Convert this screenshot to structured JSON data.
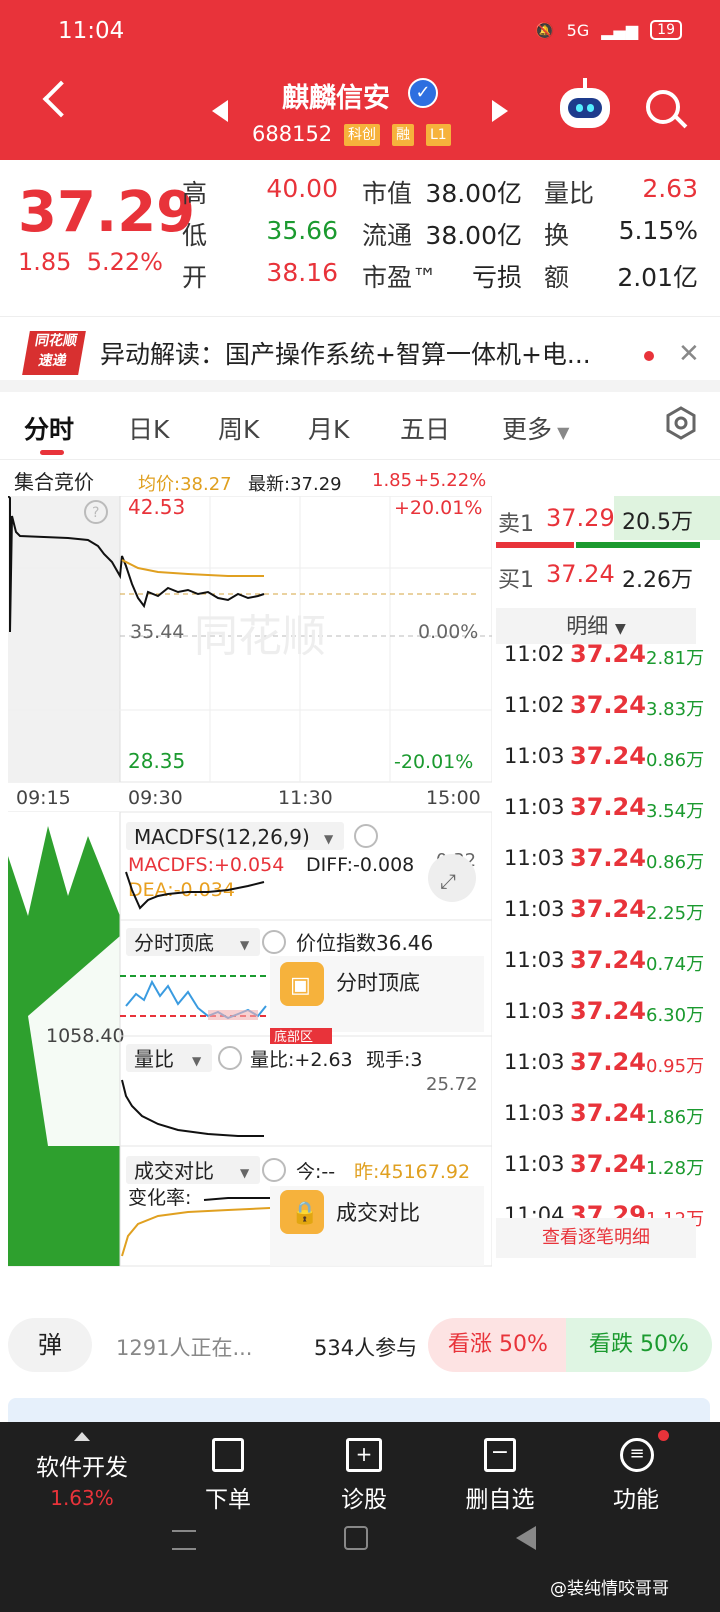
{
  "status": {
    "time": "11:04",
    "network": "5G",
    "battery": "19"
  },
  "header": {
    "name": "麒麟信安",
    "code": "688152",
    "tags": [
      "科创",
      "融",
      "L1"
    ]
  },
  "quote": {
    "price": "37.29",
    "change": "1.85",
    "pct": "5.22%",
    "rows": [
      {
        "l1": "高",
        "v1": "40.00",
        "l2": "市值",
        "v2": "38.00亿",
        "l3": "量比",
        "v3": "2.63"
      },
      {
        "l1": "低",
        "v1": "35.66",
        "l2": "流通",
        "v2": "38.00亿",
        "l3": "换",
        "v3": "5.15%"
      },
      {
        "l1": "开",
        "v1": "38.16",
        "l2": "市盈™",
        "v2": "亏损",
        "l3": "额",
        "v3": "2.01亿"
      }
    ]
  },
  "news": {
    "logo_top": "同花顺",
    "logo_bottom": "速递",
    "text": "异动解读：国产操作系统+智算一体机+电..."
  },
  "tabs": [
    "分时",
    "日K",
    "周K",
    "月K",
    "五日",
    "更多"
  ],
  "info": {
    "auction": "集合竞价",
    "avg": "均价:38.27",
    "latest": "最新:37.29",
    "chg": "1.85",
    "pct": "+5.22%"
  },
  "chart": {
    "price_high": "42.53",
    "pct_high": "+20.01%",
    "price_mid": "35.44",
    "pct_mid": "0.00%",
    "price_low": "28.35",
    "pct_low": "-20.01%",
    "watermark": "同花顺",
    "times": [
      "09:15",
      "09:30",
      "11:30",
      "15:00"
    ],
    "auction_vol": "1058.40",
    "macd": {
      "title": "MACDFS(12,26,9)",
      "macdfs": "MACDFS:+0.054",
      "diff": "DIFF:-0.008",
      "dea": "DEA:-0.034",
      "max": "0.32"
    },
    "top": {
      "title": "分时顶底",
      "idx": "价位指数36.46",
      "badge": "分时顶底",
      "cut": "底部区"
    },
    "vr": {
      "title": "量比",
      "val": "量比:+2.63",
      "hand": "现手:3",
      "max": "25.72"
    },
    "deal": {
      "title": "成交对比",
      "today": "今:--",
      "yest": "昨:45167.92",
      "rate": "变化率:",
      "badge": "成交对比"
    }
  },
  "orderbook": {
    "sell": {
      "label": "卖1",
      "price": "37.29",
      "vol": "20.5万"
    },
    "buy": {
      "label": "买1",
      "price": "37.24",
      "vol": "2.26万"
    },
    "detail": "明细",
    "ticks": [
      {
        "t": "11:02",
        "p": "37.24",
        "v": "2.81万",
        "c": "green"
      },
      {
        "t": "11:02",
        "p": "37.24",
        "v": "3.83万",
        "c": "green"
      },
      {
        "t": "11:03",
        "p": "37.24",
        "v": "0.86万",
        "c": "green"
      },
      {
        "t": "11:03",
        "p": "37.24",
        "v": "3.54万",
        "c": "green"
      },
      {
        "t": "11:03",
        "p": "37.24",
        "v": "0.86万",
        "c": "green"
      },
      {
        "t": "11:03",
        "p": "37.24",
        "v": "2.25万",
        "c": "green"
      },
      {
        "t": "11:03",
        "p": "37.24",
        "v": "0.74万",
        "c": "green"
      },
      {
        "t": "11:03",
        "p": "37.24",
        "v": "6.30万",
        "c": "green"
      },
      {
        "t": "11:03",
        "p": "37.24",
        "v": "0.95万",
        "c": "red"
      },
      {
        "t": "11:03",
        "p": "37.24",
        "v": "1.86万",
        "c": "green"
      },
      {
        "t": "11:03",
        "p": "37.24",
        "v": "1.28万",
        "c": "green"
      },
      {
        "t": "11:04",
        "p": "37.29",
        "v": "1.12万",
        "c": "red"
      }
    ],
    "more": "查看逐笔明细"
  },
  "sentiment": {
    "danmu": "弹",
    "online": "1291人正在...",
    "join": "534人参与",
    "up": "看涨 50%",
    "down": "看跌 50%"
  },
  "bottom": {
    "sector": "软件开发",
    "sector_pct": "1.63%",
    "items": [
      "下单",
      "诊股",
      "删自选",
      "功能"
    ]
  },
  "footer": {
    "watermark": "@装纯情咬哥哥"
  },
  "colors": {
    "red": "#e8333a",
    "green": "#1b9a2f",
    "orange": "#e0a020"
  }
}
